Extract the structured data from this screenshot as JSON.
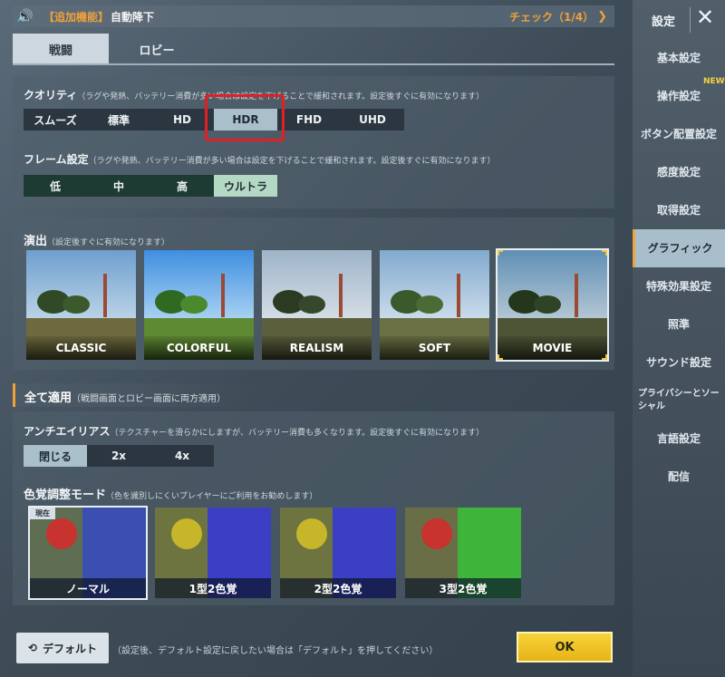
{
  "notice": {
    "tag": "【追加機能】",
    "message": "自動降下",
    "check": "チェック（1/4）"
  },
  "tabs": [
    {
      "label": "戦闘"
    },
    {
      "label": "ロビー"
    }
  ],
  "quality": {
    "title": "クオリティ",
    "note": "（ラグや発熱、バッテリー消費が多い場合は設定を下げることで緩和されます。設定後すぐに有効になります）",
    "options": [
      "スムーズ",
      "標準",
      "HD",
      "HDR",
      "FHD",
      "UHD"
    ],
    "selected": "HDR"
  },
  "frame": {
    "title": "フレーム設定",
    "note": "（ラグや発熱、バッテリー消費が多い場合は設定を下げることで緩和されます。設定後すぐに有効になります）",
    "options": [
      "低",
      "中",
      "高",
      "ウルトラ"
    ],
    "selected": "ウルトラ"
  },
  "style": {
    "title": "演出",
    "note": "（設定後すぐに有効になります）",
    "presets": [
      "CLASSIC",
      "COLORFUL",
      "REALISM",
      "SOFT",
      "MOVIE"
    ],
    "selected": "MOVIE"
  },
  "apply_all": {
    "title": "全て適用",
    "note": "（戦闘画面とロビー画面に両方適用）"
  },
  "antialias": {
    "title": "アンチエイリアス",
    "note": "（テクスチャーを滑らかにしますが、バッテリー消費も多くなります。設定後すぐに有効になります）",
    "options": [
      "閉じる",
      "2x",
      "4x"
    ],
    "selected": "閉じる"
  },
  "color_blind": {
    "title": "色覚調整モード",
    "note": "（色を識別しにくいプレイヤーにご利用をお勧めします）",
    "current_tag": "現在",
    "modes": [
      "ノーマル",
      "1型2色覚",
      "2型2色覚",
      "3型2色覚"
    ],
    "selected": "ノーマル"
  },
  "footer": {
    "default_label": "デフォルト",
    "note": "（設定後、デフォルト設定に戻したい場合は「デフォルト」を押してください）",
    "ok_label": "OK"
  },
  "sidebar": {
    "title": "設定",
    "new_badge": "NEW",
    "items": [
      {
        "label": "基本設定"
      },
      {
        "label": "操作設定"
      },
      {
        "label": "ボタン配置設定"
      },
      {
        "label": "感度設定"
      },
      {
        "label": "取得設定"
      },
      {
        "label": "グラフィック"
      },
      {
        "label": "特殊効果設定"
      },
      {
        "label": "照準"
      },
      {
        "label": "サウンド設定"
      },
      {
        "label": "プライバシーとソーシャル"
      },
      {
        "label": "言語設定"
      },
      {
        "label": "配信"
      }
    ],
    "active": "グラフィック"
  },
  "colors": {
    "accent_orange": "#f0a13a",
    "highlight_red": "#e21f25",
    "ok_yellow": "#f7d43a"
  }
}
